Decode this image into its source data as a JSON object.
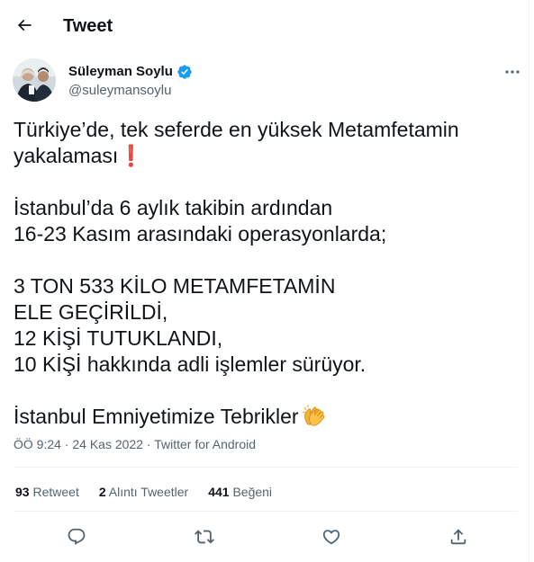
{
  "header": {
    "title": "Tweet",
    "back_icon": "arrow-left-icon"
  },
  "author": {
    "name": "Süleyman Soylu",
    "handle": "@suleymansoylu",
    "verified_color": "#1d9bf0"
  },
  "tweet": {
    "lines": [
      "Türkiye’de, tek seferde en yüksek Metamfetamin",
      "yakalaması",
      "İstanbul’da 6 aylık takibin ardından",
      "16-23 Kasım arasındaki operasyonlarda;",
      "3 TON 533 KİLO METAMFETAMİN",
      "ELE GEÇİRİLDİ,",
      "12 KİŞİ TUTUKLANDI,",
      "10 KİŞİ hakkında adli işlemler sürüyor.",
      "İstanbul Emniyetimize Tebrikler"
    ],
    "exclamation_emoji": "❗",
    "clap_emoji": "clapping-hands-icon"
  },
  "meta": {
    "time": "ÖÖ 9:24",
    "separator": " · ",
    "date": "24 Kas 2022",
    "source": "Twitter for Android"
  },
  "stats": {
    "retweets_count": "93",
    "retweets_label": "Retweet",
    "quotes_count": "2",
    "quotes_label": "Alıntı Tweetler",
    "likes_count": "441",
    "likes_label": "Beğeni"
  },
  "actions": [
    "reply-icon",
    "retweet-icon",
    "like-icon",
    "share-icon"
  ],
  "colors": {
    "text": "#0f1419",
    "secondary": "#536471",
    "divider": "#eff3f4"
  }
}
